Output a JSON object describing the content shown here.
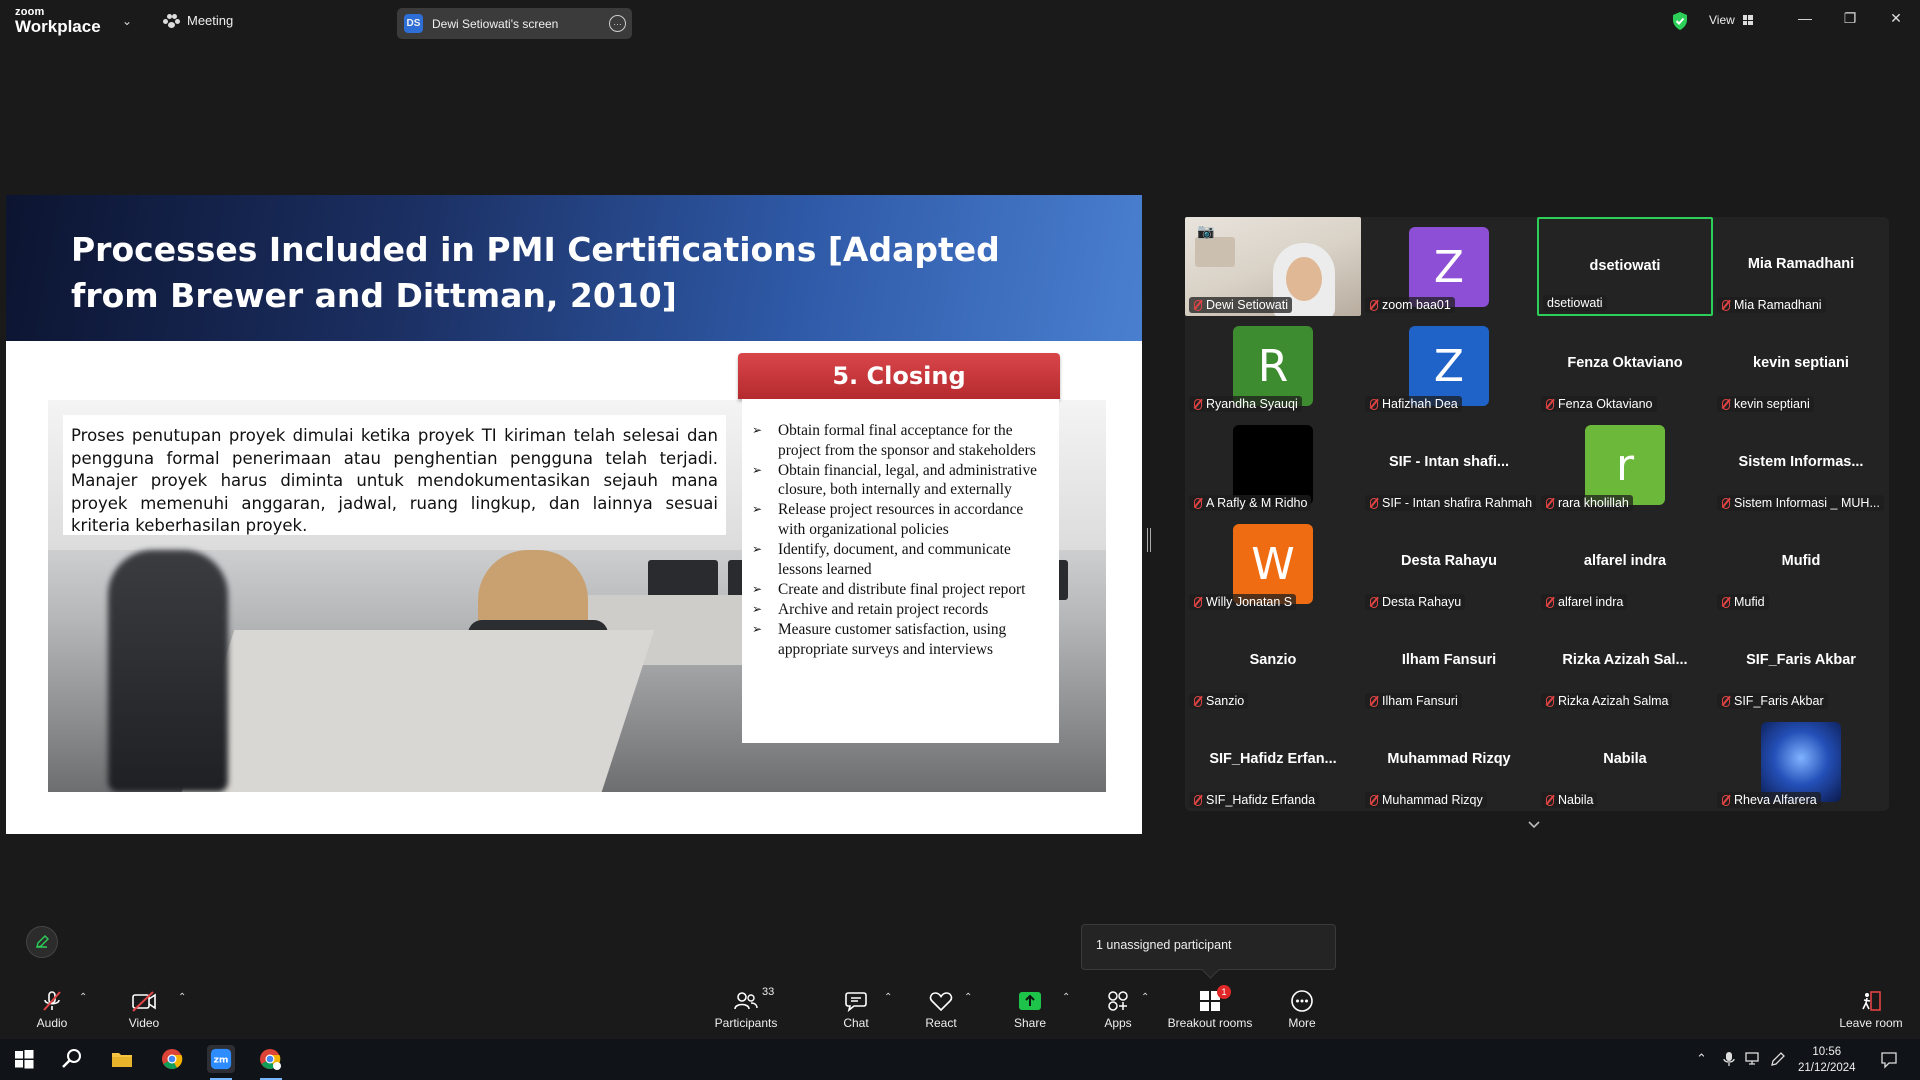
{
  "app": {
    "logo_line1": "zoom",
    "logo_line2": "Workplace",
    "meeting_label": "Meeting",
    "share_tab": {
      "initials": "DS",
      "label": "Dewi Setiowati's screen"
    },
    "view_label": "View",
    "secure_color": "#2cd058"
  },
  "slide": {
    "title": "Processes Included in PMI Certifications [Adapted from Brewer and Dittman, 2010]",
    "paragraph": "Proses penutupan proyek dimulai ketika proyek TI kiriman telah selesai dan pengguna formal penerimaan atau penghentian pengguna telah terjadi. Manajer proyek harus diminta untuk mendokumentasikan sejauh mana proyek memenuhi anggaran, jadwal, ruang lingkup, dan lainnya sesuai kriteria keberhasilan proyek.",
    "closing_header": "5. Closing",
    "closing_items": [
      "Obtain formal final acceptance for the project from the sponsor and stakeholders",
      "Obtain financial, legal, and administrative closure, both internally and externally",
      "Release project resources in accordance with organizational policies",
      "Identify, document, and communicate lessons learned",
      "Create and distribute final project report",
      "Archive and retain project records",
      "Measure customer satisfaction, using appropriate surveys and interviews"
    ]
  },
  "gallery": {
    "tiles": [
      {
        "label": "Dewi Setiowati",
        "type": "video"
      },
      {
        "label": "zoom baa01",
        "type": "avatar",
        "letter": "Z",
        "color": "#8d4fd6"
      },
      {
        "label": "dsetiowati",
        "type": "name",
        "name": "dsetiowati",
        "active": true
      },
      {
        "label": "Mia Ramadhani",
        "type": "name",
        "name": "Mia Ramadhani"
      },
      {
        "label": "Ryandha Syauqi",
        "type": "avatar",
        "letter": "R",
        "color": "#3d8c2f"
      },
      {
        "label": "Hafizhah Dea",
        "type": "avatar",
        "letter": "Z",
        "color": "#1f63c8"
      },
      {
        "label": "Fenza Oktaviano",
        "type": "name",
        "name": "Fenza Oktaviano"
      },
      {
        "label": "kevin septiani",
        "type": "name",
        "name": "kevin septiani"
      },
      {
        "label": "A Rafly & M Ridho",
        "type": "black"
      },
      {
        "label": "SIF - Intan shafira Rahmah",
        "type": "name",
        "name": "SIF - Intan shafi..."
      },
      {
        "label": "rara kholillah",
        "type": "avatar",
        "letter": "r",
        "color": "#6bb83a"
      },
      {
        "label": "Sistem Informasi _ MUH...",
        "type": "name",
        "name": "Sistem Informas..."
      },
      {
        "label": "Willy Jonatan S",
        "type": "avatar",
        "letter": "W",
        "color": "#ef6c12"
      },
      {
        "label": "Desta Rahayu",
        "type": "name",
        "name": "Desta Rahayu"
      },
      {
        "label": "alfarel indra",
        "type": "name",
        "name": "alfarel indra"
      },
      {
        "label": "Mufid",
        "type": "name",
        "name": "Mufid"
      },
      {
        "label": "Sanzio",
        "type": "name",
        "name": "Sanzio"
      },
      {
        "label": "Ilham Fansuri",
        "type": "name",
        "name": "Ilham Fansuri"
      },
      {
        "label": "Rizka Azizah Salma",
        "type": "name",
        "name": "Rizka Azizah Sal..."
      },
      {
        "label": "SIF_Faris Akbar",
        "type": "name",
        "name": "SIF_Faris Akbar"
      },
      {
        "label": "SIF_Hafidz Erfanda",
        "type": "name",
        "name": "SIF_Hafidz Erfan..."
      },
      {
        "label": "Muhammad Rizqy",
        "type": "name",
        "name": "Muhammad Rizqy"
      },
      {
        "label": "Nabila",
        "type": "name",
        "name": "Nabila"
      },
      {
        "label": "Rheva Alfarera",
        "type": "image"
      }
    ]
  },
  "popover": {
    "unassigned": "1 unassigned participant"
  },
  "toolbar": {
    "audio": "Audio",
    "video": "Video",
    "participants": "Participants",
    "participants_count": "33",
    "chat": "Chat",
    "react": "React",
    "share": "Share",
    "apps": "Apps",
    "breakout": "Breakout rooms",
    "breakout_badge": "1",
    "more": "More",
    "leave": "Leave room",
    "share_color": "#1ec44a"
  },
  "taskbar": {
    "time": "10:56",
    "date": "21/12/2024"
  }
}
